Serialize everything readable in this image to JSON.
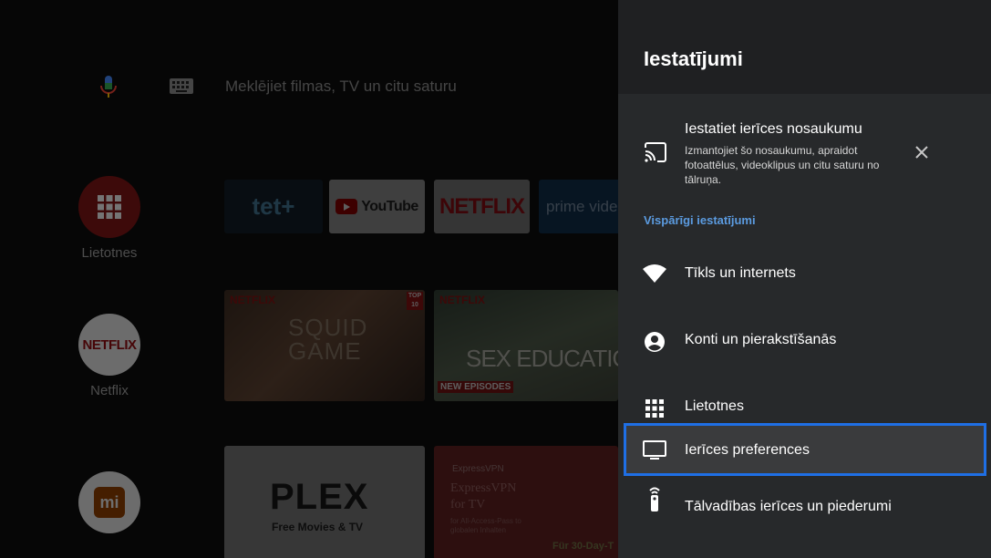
{
  "search": {
    "placeholder": "Meklējiet filmas, TV un citu saturu",
    "mic_icon": "mic-icon",
    "keyboard_icon": "keyboard-icon"
  },
  "home_sidebar": {
    "items": [
      {
        "label": "Lietotnes",
        "icon": "apps-grid-icon",
        "color": "#e53935"
      },
      {
        "label": "Netflix",
        "icon": "netflix-logo",
        "color": "#e50914"
      },
      {
        "label": "",
        "icon": "mi-logo",
        "color": "#ff6900"
      }
    ]
  },
  "app_row": {
    "apps": [
      {
        "label": "tet+"
      },
      {
        "label": "YouTube"
      },
      {
        "label": "NETFLIX"
      },
      {
        "label": "prime video"
      }
    ]
  },
  "netflix_row": {
    "cards": [
      {
        "brand": "NETFLIX",
        "title": "SQUID GAME",
        "badge": "TOP 10"
      },
      {
        "brand": "NETFLIX",
        "title": "SEX EDUCATION",
        "tag": "NEW EPISODES"
      }
    ]
  },
  "bottom_row": {
    "cards": [
      {
        "title": "PLEX",
        "subtitle": "Free Movies & TV"
      },
      {
        "brand": "ExpressVPN",
        "title": "ExpressVPN for TV",
        "subtitle": "for All-Access-Pass to globalen Inhalten",
        "footer": "Für 30-Day-T"
      }
    ]
  },
  "settings_panel": {
    "title": "Iestatījumi",
    "suggestion": {
      "icon": "cast-icon",
      "title": "Iestatiet ierīces nosaukumu",
      "description": "Izmantojiet šo nosaukumu, apraidot fotoattēlus, videoklipus un citu saturu no tālruņa.",
      "close_icon": "close-icon"
    },
    "section_label": "Vispārīgi iestatījumi",
    "items": [
      {
        "label": "Tīkls un internets",
        "icon": "wifi-icon"
      },
      {
        "label": "Konti un pierakstīšanās",
        "icon": "account-circle-icon"
      },
      {
        "label": "Lietotnes",
        "icon": "apps-grid-icon"
      },
      {
        "label": "Ierīces preferences",
        "icon": "tv-icon",
        "selected": true
      },
      {
        "label": "Tālvadības ierīces un piederumi",
        "icon": "remote-icon"
      }
    ]
  },
  "colors": {
    "accent_focus": "#1f6fe5",
    "section_label": "#5b9be0",
    "panel_bg": "#27292b"
  }
}
